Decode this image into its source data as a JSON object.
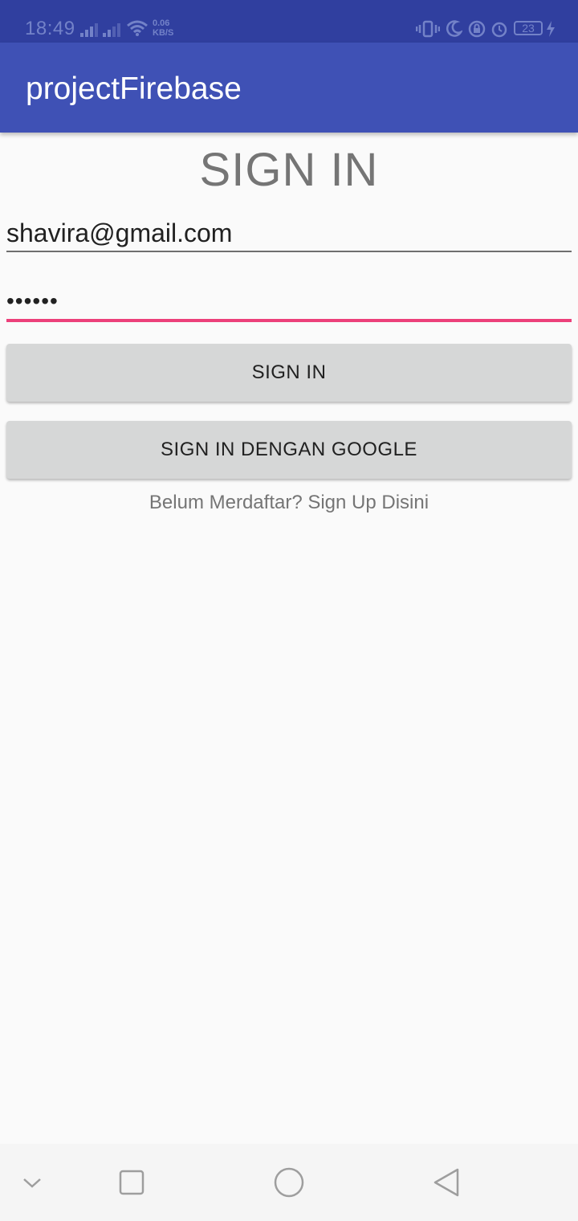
{
  "status_bar": {
    "time": "18:49",
    "net_speed_value": "0.06",
    "net_speed_unit": "KB/S",
    "battery_level": "23",
    "icons": [
      "signal-icon",
      "signal-icon",
      "wifi-icon",
      "vibrate-icon",
      "moon-icon",
      "rotation-lock-icon",
      "alarm-icon",
      "battery-icon",
      "charging-icon"
    ]
  },
  "app_bar": {
    "title": "projectFirebase"
  },
  "main": {
    "heading": "SIGN IN",
    "email_value": "shavira@gmail.com",
    "password_value": "••••••",
    "sign_in_label": "SIGN IN",
    "google_sign_in_label": "SIGN IN DENGAN GOOGLE",
    "signup_link": "Belum Merdaftar? Sign Up Disini"
  },
  "nav_bar": {
    "icons": [
      "chevron-down-icon",
      "recents-icon",
      "home-icon",
      "back-icon"
    ]
  },
  "colors": {
    "status_bar": "#303f9f",
    "app_bar": "#3f51b5",
    "accent": "#ec407a",
    "button": "#d6d7d7",
    "background": "#fafafa"
  }
}
